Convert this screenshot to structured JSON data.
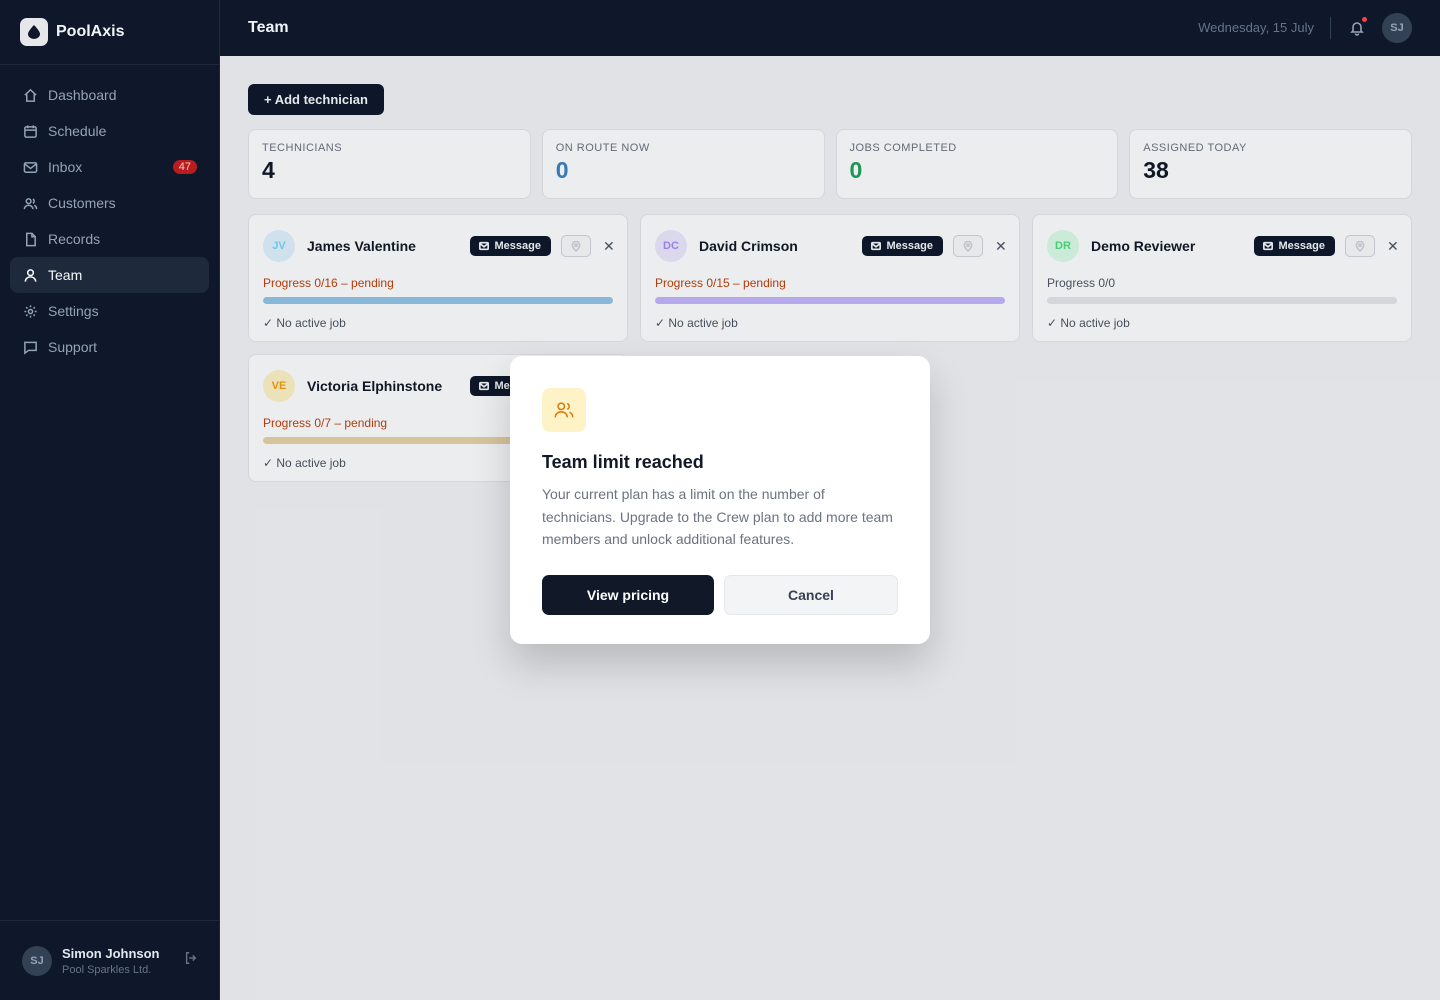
{
  "app": {
    "name": "PoolAxis"
  },
  "sidebar": {
    "items": [
      {
        "label": "Dashboard",
        "icon": "home-icon",
        "active": false
      },
      {
        "label": "Schedule",
        "icon": "calendar-icon",
        "active": false
      },
      {
        "label": "Inbox",
        "icon": "mail-icon",
        "active": false,
        "badge": "47"
      },
      {
        "label": "Customers",
        "icon": "users-icon",
        "active": false
      },
      {
        "label": "Records",
        "icon": "file-icon",
        "active": false
      },
      {
        "label": "Team",
        "icon": "user-icon",
        "active": true
      },
      {
        "label": "Settings",
        "icon": "gear-icon",
        "active": false
      },
      {
        "label": "Support",
        "icon": "chat-icon",
        "active": false
      }
    ],
    "user": {
      "initials": "SJ",
      "name": "Simon Johnson",
      "org": "Pool Sparkles Ltd."
    }
  },
  "header": {
    "title": "Team",
    "date": "Wednesday, 15 July",
    "avatar": "SJ"
  },
  "main": {
    "add_button": "+ Add technician",
    "stats": [
      {
        "label": "TECHNICIANS",
        "value": "4",
        "color": "#111827"
      },
      {
        "label": "ON ROUTE NOW",
        "value": "0",
        "color": "#3b82c4"
      },
      {
        "label": "JOBS COMPLETED",
        "value": "0",
        "color": "#22a05a"
      },
      {
        "label": "ASSIGNED TODAY",
        "value": "38",
        "color": "#111827"
      }
    ],
    "technicians": [
      {
        "initials": "JV",
        "name": "James Valentine",
        "message": "Message",
        "progress": "Progress 0/16 – pending",
        "progress_color": "#c2410c",
        "fill": 1.0,
        "bar_color": "#93c5e8",
        "avatar_bg": "#e0f2fe",
        "avatar_fg": "#7dd3fc",
        "job": "✓ No active job"
      },
      {
        "initials": "DC",
        "name": "David Crimson",
        "message": "Message",
        "progress": "Progress 0/15 – pending",
        "progress_color": "#c2410c",
        "fill": 1.0,
        "bar_color": "#c4b5fd",
        "avatar_bg": "#ede9fe",
        "avatar_fg": "#a78bfa",
        "job": "✓ No active job"
      },
      {
        "initials": "DR",
        "name": "Demo Reviewer",
        "message": "Message",
        "progress": "Progress 0/0",
        "progress_color": "#4b5563",
        "fill": 0.0,
        "bar_color": "#e5e7eb",
        "avatar_bg": "#dcfce7",
        "avatar_fg": "#4ade80",
        "job": "✓ No active job"
      },
      {
        "initials": "VE",
        "name": "Victoria Elphinstone",
        "message": "Message",
        "progress": "Progress 0/7 – pending",
        "progress_color": "#c2410c",
        "fill": 1.0,
        "bar_color": "#e8d3a8",
        "avatar_bg": "#fef3c7",
        "avatar_fg": "#f59e0b",
        "job": "✓ No active job"
      }
    ]
  },
  "modal": {
    "icon": "users-icon",
    "title": "Team limit reached",
    "body": "Your current plan has a limit on the number of technicians. Upgrade to the Crew plan to add more team members and unlock additional features.",
    "primary": "View pricing",
    "secondary": "Cancel"
  }
}
